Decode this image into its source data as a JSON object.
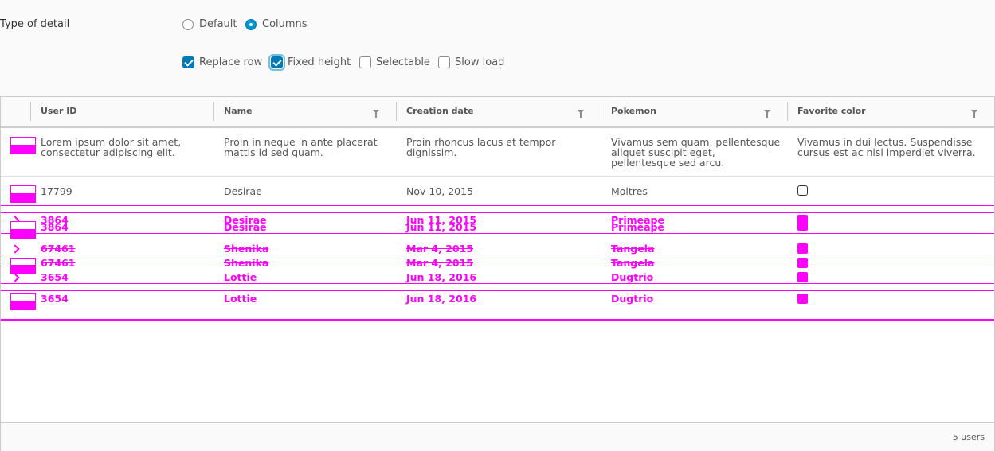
{
  "options": {
    "type_label": "Type of detail",
    "radios": [
      {
        "label": "Default",
        "checked": false
      },
      {
        "label": "Columns",
        "checked": true
      }
    ],
    "checkboxes": [
      {
        "label": "Replace row",
        "checked": true
      },
      {
        "label": "Fixed height",
        "checked": true
      },
      {
        "label": "Selectable",
        "checked": false
      },
      {
        "label": "Slow load",
        "checked": false
      }
    ]
  },
  "grid": {
    "columns": [
      "User ID",
      "Name",
      "Creation date",
      "Pokemon",
      "Favorite color"
    ],
    "detail_row": {
      "user_id": "Lorem ipsum dolor sit amet,\nconsectetur adipiscing elit.",
      "name": "Proin in neque in ante placerat\nmattis id sed quam.",
      "date": "Proin rhoncus lacus et tempor\ndignissim.",
      "pokemon": "Vivamus sem quam, pellentesque\naliquet suscipit eget,\npellentesque sed arcu.",
      "color": "Vivamus in dui lectus. Suspendisse\ncursus est ac nisl imperdiet viverra."
    },
    "rows": [
      {
        "id": "17799",
        "name": "Desirae",
        "date": "Nov 10, 2015",
        "pokemon": "Moltres"
      },
      {
        "id": "3864",
        "name": "Desirae",
        "date": "Jun 11, 2015",
        "pokemon": "Primeape"
      },
      {
        "id": "67461",
        "name": "Shenika",
        "date": "Mar 4, 2015",
        "pokemon": "Tangela"
      },
      {
        "id": "3654",
        "name": "Lottie",
        "date": "Jun 18, 2016",
        "pokemon": "Dugtrio"
      }
    ],
    "footer": "5 users"
  },
  "colors": {
    "accent": "#0079b8",
    "ghost": "#ff00ff"
  }
}
